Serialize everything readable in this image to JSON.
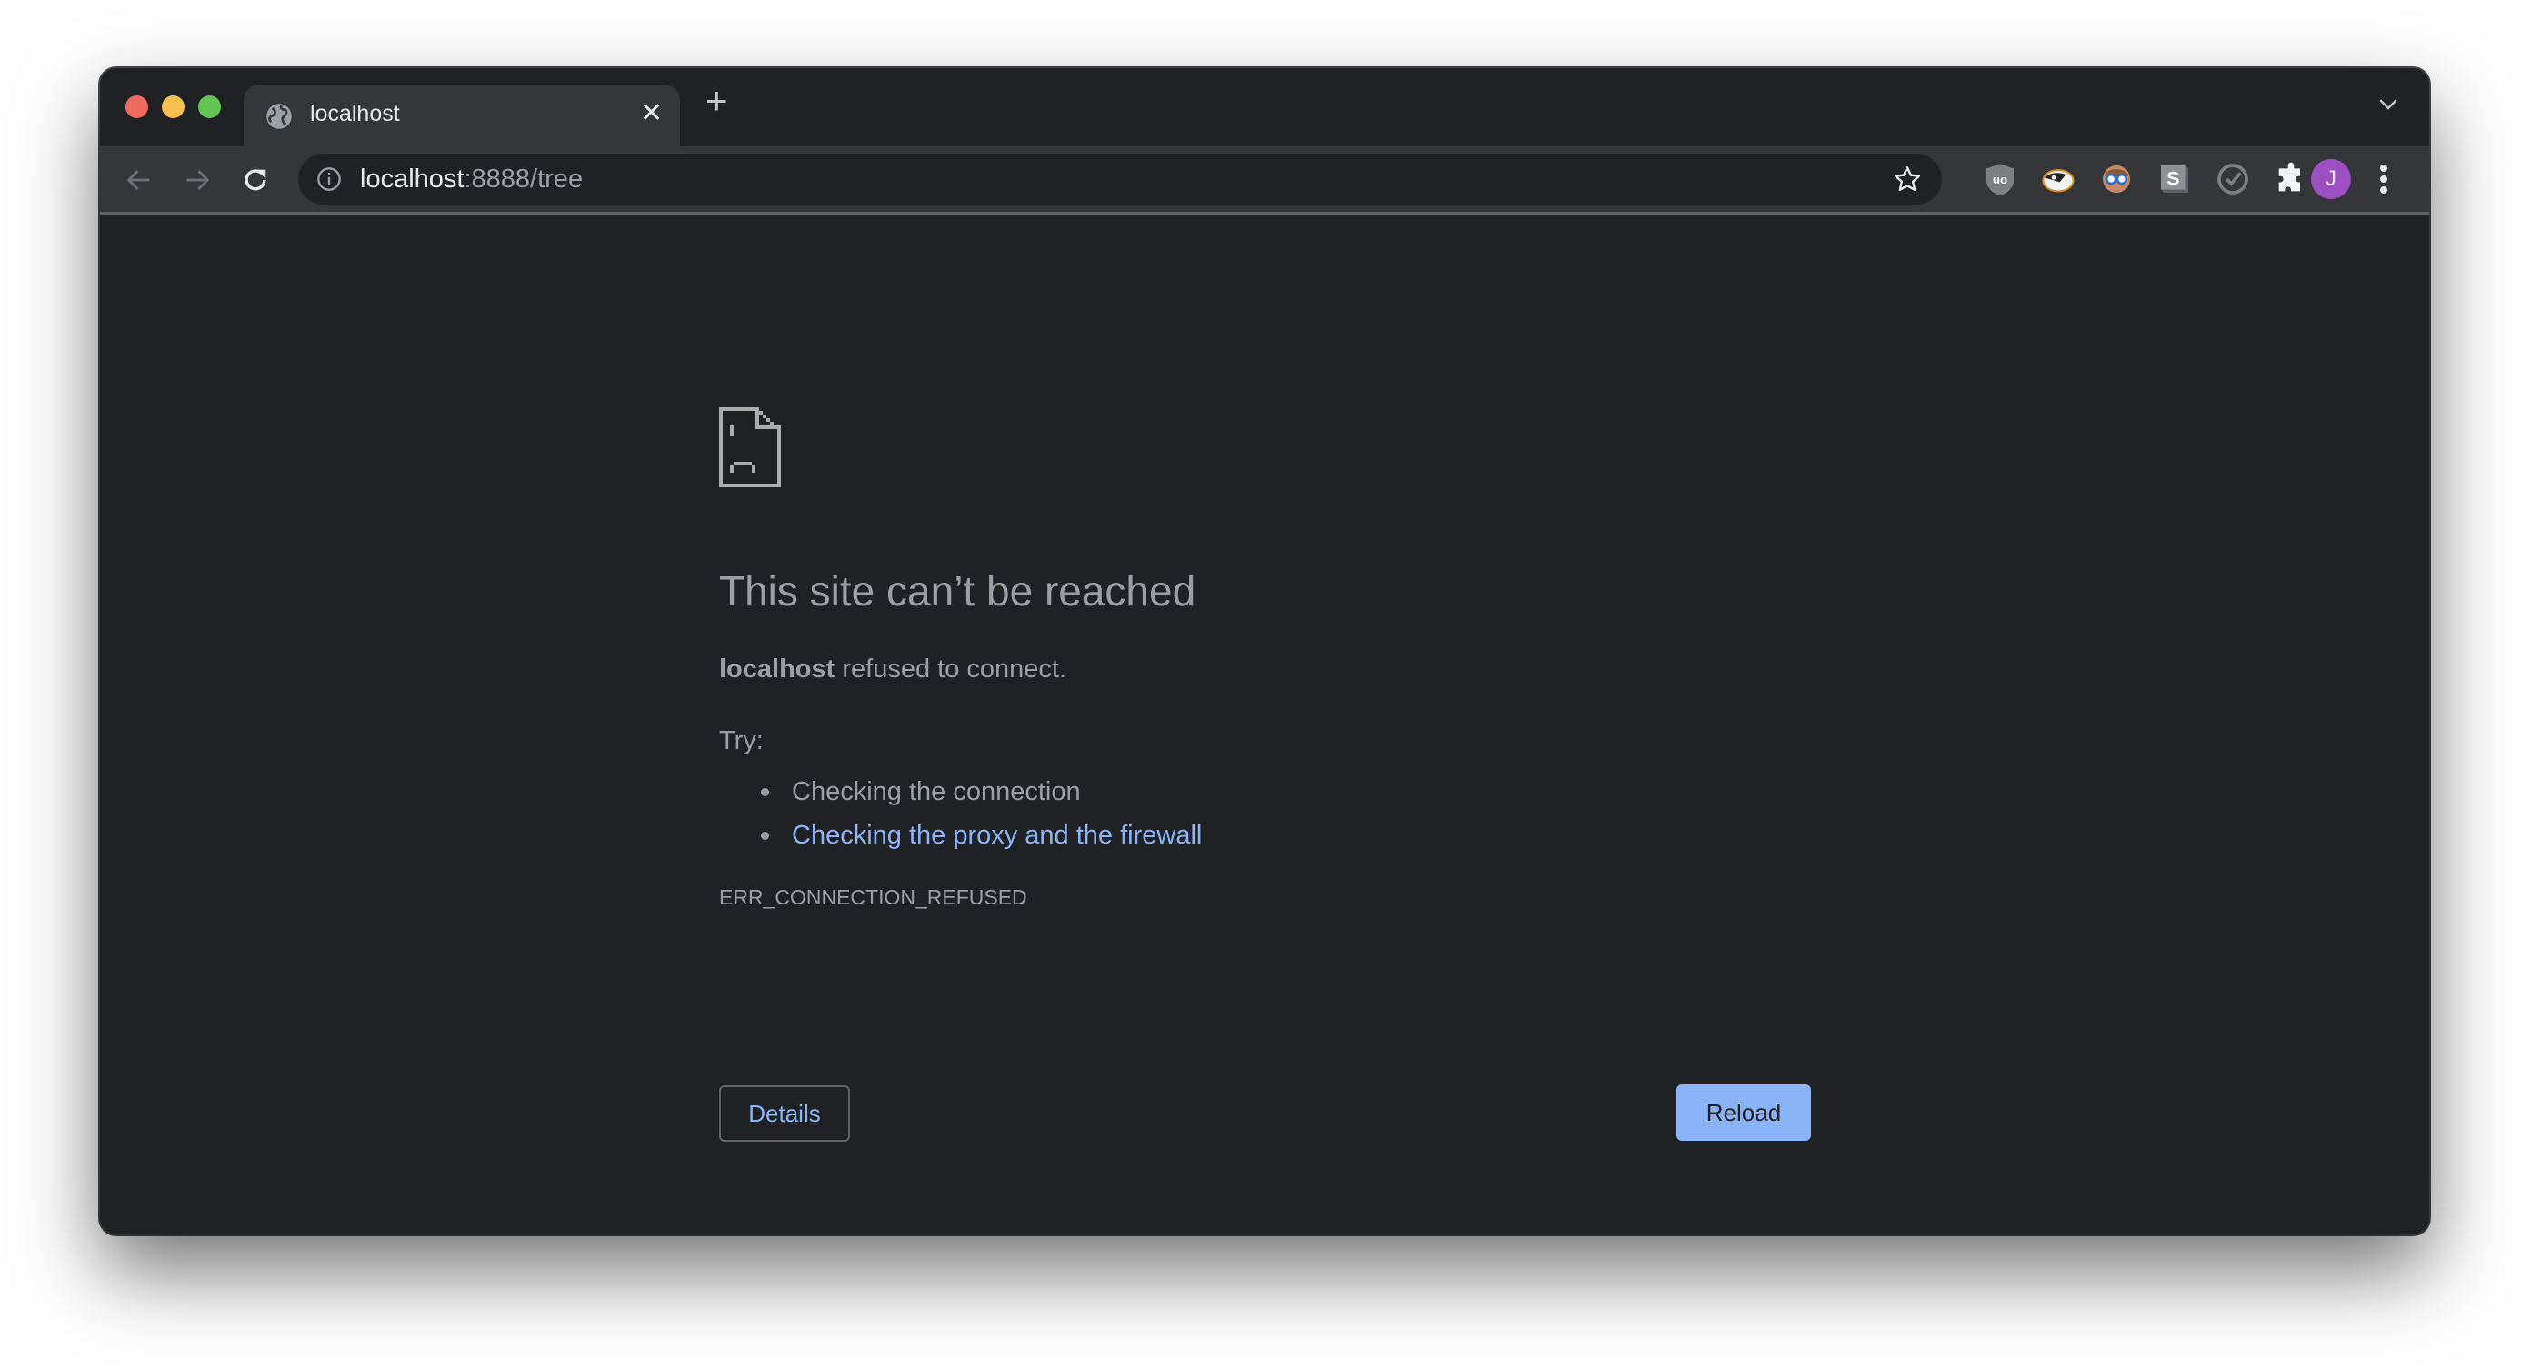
{
  "browser": {
    "tab": {
      "title": "localhost",
      "favicon": "globe-icon"
    },
    "new_tab_label": "+",
    "omnibox": {
      "host": "localhost",
      "rest": ":8888/tree",
      "info_icon": "info-icon"
    },
    "extensions": [
      "ublock-origin-icon",
      "privacy-badger-icon",
      "extension-face-glasses-icon",
      "s-extension-icon",
      "checkmark-circle-icon",
      "extensions-puzzle-icon"
    ],
    "avatar_initial": "J",
    "colors": {
      "accent": "#8ab4f8",
      "background": "#202124",
      "toolbar": "#35363a",
      "avatar": "#9c4fc0"
    }
  },
  "error_page": {
    "icon": "sad-page-icon",
    "headline": "This site can’t be reached",
    "host": "localhost",
    "message": " refused to connect.",
    "try_label": "Try:",
    "suggestions": [
      {
        "text": "Checking the connection",
        "is_link": false
      },
      {
        "text": "Checking the proxy and the firewall",
        "is_link": true
      }
    ],
    "error_code": "ERR_CONNECTION_REFUSED",
    "details_button": "Details",
    "reload_button": "Reload"
  }
}
